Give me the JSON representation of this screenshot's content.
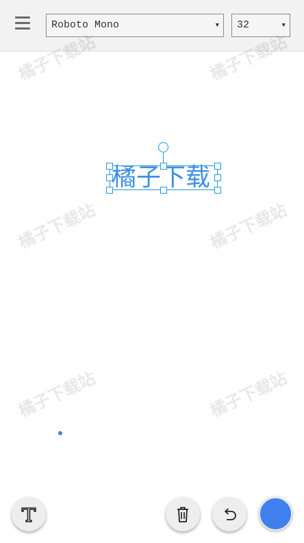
{
  "toolbar": {
    "font_family": "Roboto Mono",
    "font_size": "32"
  },
  "canvas": {
    "text": "橘子下载",
    "text_color": "#3f8fe6",
    "selection_color": "#1e9ad6"
  },
  "watermark": {
    "text": "橘子下载站"
  },
  "bottom_bar": {
    "current_color": "#3f80ee"
  }
}
